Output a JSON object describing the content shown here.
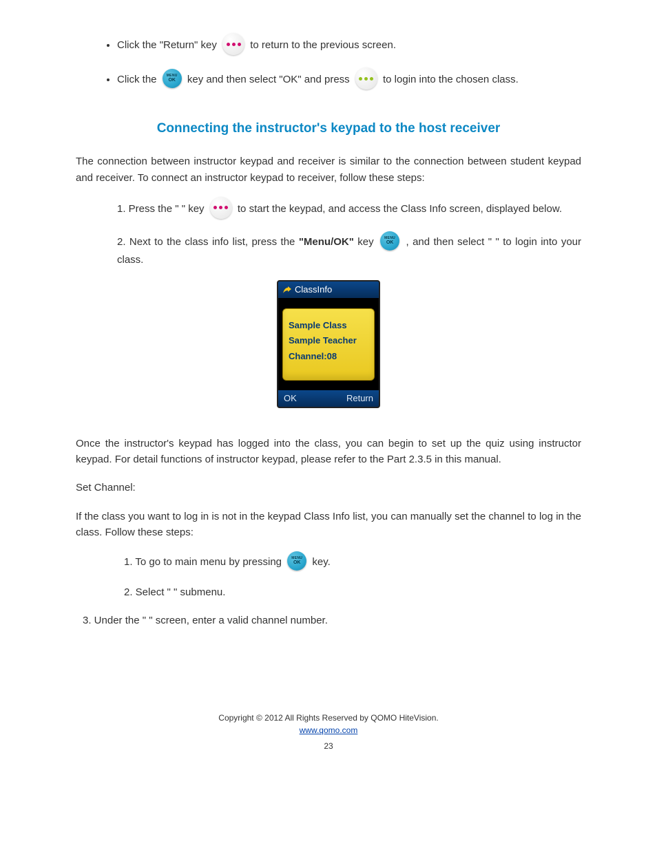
{
  "bullets": {
    "b1_pre": "Click the ",
    "b1_quoted": "\"Return\"",
    "b1_mid": " key ",
    "b1_post": " to return to the previous screen.",
    "b2_pre": "Click the ",
    "b2_mid": " key and then select ",
    "b2_quoted": "\"OK\"",
    "b2_post": "and press ",
    "b2_after": "to login into the chosen class."
  },
  "heading": "Connecting the instructor's keypad to the host receiver",
  "p1": "The connection between instructor keypad and receiver is similar to the connection between student keypad and receiver. To connect an instructor keypad to receiver, follow these steps:",
  "steps": {
    "s1_pre": "1.    Press the",
    "s1_quoted": " \"       \" ",
    "s1_mid": "key ",
    "s1_post": "to start the keypad, and access the Class Info screen, displayed below.",
    "s2_pre": "2.    Next to the class info list, press the",
    "s2_quoted": " \"Menu/OK\" ",
    "s2_mid": "key ",
    "s2_post": ", and then select ",
    "s2_quoted2": "\"        \"",
    "s2_tail": " to login into your class."
  },
  "device": {
    "title": "ClassInfo",
    "line1": "Sample  Class",
    "line2": "Sample  Teacher",
    "line3": "Channel:08",
    "ok": "OK",
    "return": "Return"
  },
  "p2": "Once the instructor's keypad has logged into the class, you can begin to set up the quiz using instructor keypad. For detail functions of instructor keypad, please refer to the Part 2.3.5 in this manual.",
  "setchan": {
    "title": "Set Channel:",
    "desc": "If the class you want to log in is not in the keypad Class Info list, you can manually set the channel to log in the class. Follow these steps:",
    "s1_pre": "1.    To go to main menu by pressing ",
    "s1_post": " key.",
    "s2_pre": "2.    Select ",
    "s2_quoted": "\"                    \"",
    "s2_post": " submenu.",
    "s3_pre": "3.    Under the ",
    "s3_quoted": "\"                  \"",
    "s3_post": " screen, enter a valid channel number."
  },
  "footer": {
    "line1_pre": "Copyright © 2012 All Rights Reserved by QOMO HiteVision.",
    "link": "www.qomo.com",
    "pageno": "23"
  }
}
